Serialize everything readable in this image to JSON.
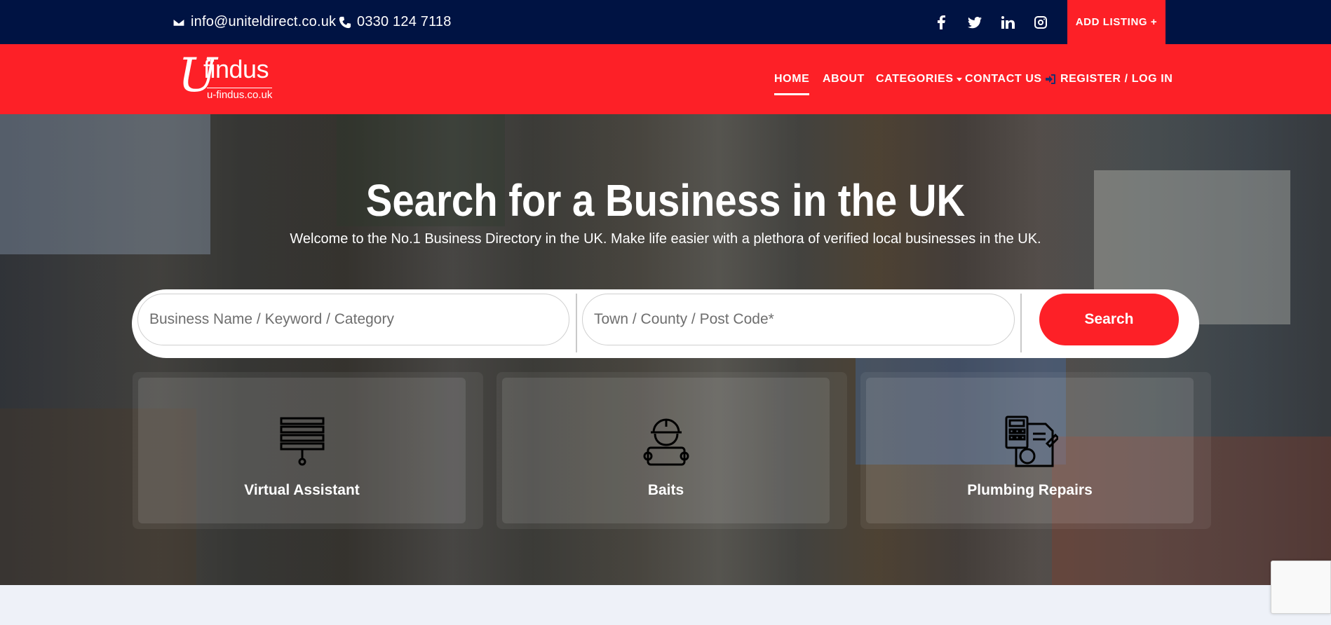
{
  "topbar": {
    "email": "info@uniteldirect.co.uk",
    "phone": "0330 124 7118",
    "social": [
      "facebook-icon",
      "twitter-icon",
      "linkedin-icon",
      "instagram-icon"
    ],
    "add_listing": "ADD LISTING +"
  },
  "logo": {
    "letter": "U",
    "name": "findus",
    "domain": "u-findus.co.uk"
  },
  "nav": {
    "home": "HOME",
    "about": "ABOUT",
    "categories": "CATEGORIES",
    "contact": "CONTACT US",
    "register": "REGISTER / LOG IN"
  },
  "hero": {
    "title": "Search for a Business in the UK",
    "subtitle": "Welcome to the No.1 Business Directory in the UK. Make life easier with a plethora of verified local businesses in the UK."
  },
  "search": {
    "keyword_placeholder": "Business Name / Keyword / Category",
    "location_placeholder": "Town / County / Post Code*",
    "button": "Search"
  },
  "categories": [
    {
      "label": "Virtual Assistant",
      "icon": "pallet-icon"
    },
    {
      "label": "Baits",
      "icon": "worker-icon"
    },
    {
      "label": "Plumbing Repairs",
      "icon": "accounting-icon"
    }
  ],
  "colors": {
    "topbar_bg": "#001343",
    "accent_red": "#fd2027",
    "page_bg": "#eef1f8"
  }
}
